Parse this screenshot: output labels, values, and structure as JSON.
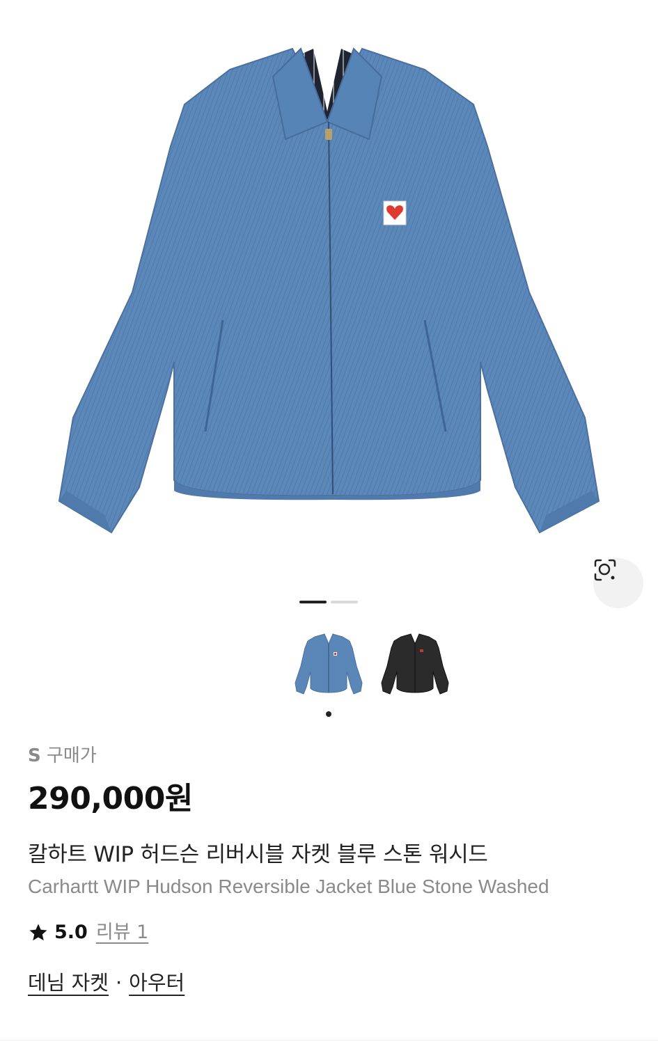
{
  "product": {
    "size_letter": "S",
    "size_purchase_label": "구매가",
    "price": "290,000원",
    "name_ko": "칼하트 WIP 허드슨 리버시블 자켓 블루 스톤 워시드",
    "name_en": "Carhartt WIP Hudson Reversible Jacket Blue Stone Washed",
    "rating": "5.0",
    "review_label": "리뷰 1",
    "category_primary": "데님 자켓",
    "category_separator": "·",
    "category_secondary": "아우터"
  },
  "gallery": {
    "total_pages": 2,
    "active_page": 1,
    "thumbnails": [
      "blue-denim-jacket",
      "black-jacket"
    ],
    "selected_thumbnail": 0
  },
  "colors": {
    "denim": "#5a86b8",
    "denim_dark": "#4a73a3",
    "black_jacket": "#2b2b2b",
    "label_red": "#e03a2f",
    "muted_text": "#8a8a8a"
  },
  "icons": {
    "lens": "image-search-icon",
    "star": "star-icon"
  }
}
